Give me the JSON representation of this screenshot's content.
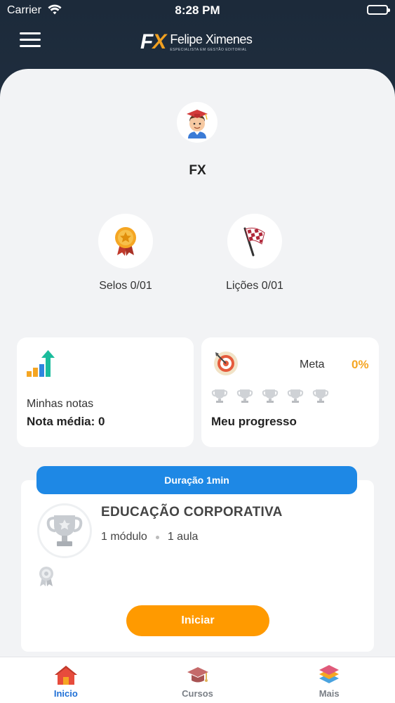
{
  "status_bar": {
    "carrier": "Carrier",
    "time": "8:28 PM"
  },
  "header": {
    "logo_mark_f": "F",
    "logo_mark_x": "X",
    "logo_name": "Felipe Ximenes",
    "logo_tagline": "ESPECIALISTA EM GESTÃO EDITORIAL"
  },
  "profile": {
    "name": "FX"
  },
  "stats": {
    "seals": "Selos 0/01",
    "lessons": "Lições 0/01"
  },
  "notes_card": {
    "title": "Minhas notas",
    "average": "Nota média: 0"
  },
  "progress_card": {
    "meta_label": "Meta",
    "meta_value": "0%",
    "title": "Meu progresso",
    "trophy_count": 5
  },
  "course": {
    "duration": "Duração 1min",
    "title": "EDUCAÇÃO CORPORATIVA",
    "modules": "1 módulo",
    "lessons": "1 aula",
    "start_label": "Iniciar"
  },
  "tabs": [
    {
      "label": "Inicio",
      "icon": "home-icon",
      "active": true
    },
    {
      "label": "Cursos",
      "icon": "graduation-cap-icon",
      "active": false
    },
    {
      "label": "Mais",
      "icon": "layers-icon",
      "active": false
    }
  ],
  "colors": {
    "accent": "#1e88e5",
    "cta": "#ff9a00",
    "highlight": "#f5a623",
    "active_tab": "#1e6fd6"
  }
}
